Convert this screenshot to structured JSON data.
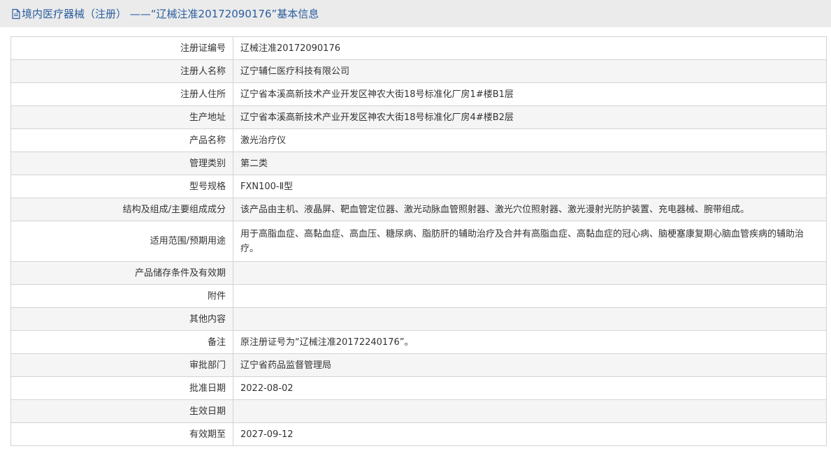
{
  "header": {
    "icon": "document-icon",
    "title": "境内医疗器械（注册） ——“辽械注准20172090176”基本信息",
    "color": "#2a5d9f"
  },
  "rows": [
    {
      "label": "注册证编号",
      "value": "辽械注准20172090176"
    },
    {
      "label": "注册人名称",
      "value": "辽宁辅仁医疗科技有限公司"
    },
    {
      "label": "注册人住所",
      "value": "辽宁省本溪高新技术产业开发区神农大街18号标准化厂房1#楼B1层"
    },
    {
      "label": "生产地址",
      "value": "辽宁省本溪高新技术产业开发区神农大街18号标准化厂房4#楼B2层"
    },
    {
      "label": "产品名称",
      "value": "激光治疗仪"
    },
    {
      "label": "管理类别",
      "value": "第二类"
    },
    {
      "label": "型号规格",
      "value": "FXN100-Ⅱ型"
    },
    {
      "label": "结构及组成/主要组成成分",
      "value": "该产品由主机、液晶屏、靶血管定位器、激光动脉血管照射器、激光穴位照射器、激光漫射光防护装置、充电器械、腕带组成。"
    },
    {
      "label": "适用范围/预期用途",
      "value": "用于高脂血症、高黏血症、高血压、糖尿病、脂肪肝的辅助治疗及合并有高脂血症、高黏血症的冠心病、脑梗塞康复期心脑血管疾病的辅助治疗。"
    },
    {
      "label": "产品储存条件及有效期",
      "value": ""
    },
    {
      "label": "附件",
      "value": ""
    },
    {
      "label": "其他内容",
      "value": ""
    },
    {
      "label": "备注",
      "value": "原注册证号为“辽械注准20172240176”。"
    },
    {
      "label": "审批部门",
      "value": "辽宁省药品监督管理局"
    },
    {
      "label": "批准日期",
      "value": "2022-08-02"
    },
    {
      "label": "生效日期",
      "value": ""
    },
    {
      "label": "有效期至",
      "value": "2027-09-12"
    }
  ]
}
